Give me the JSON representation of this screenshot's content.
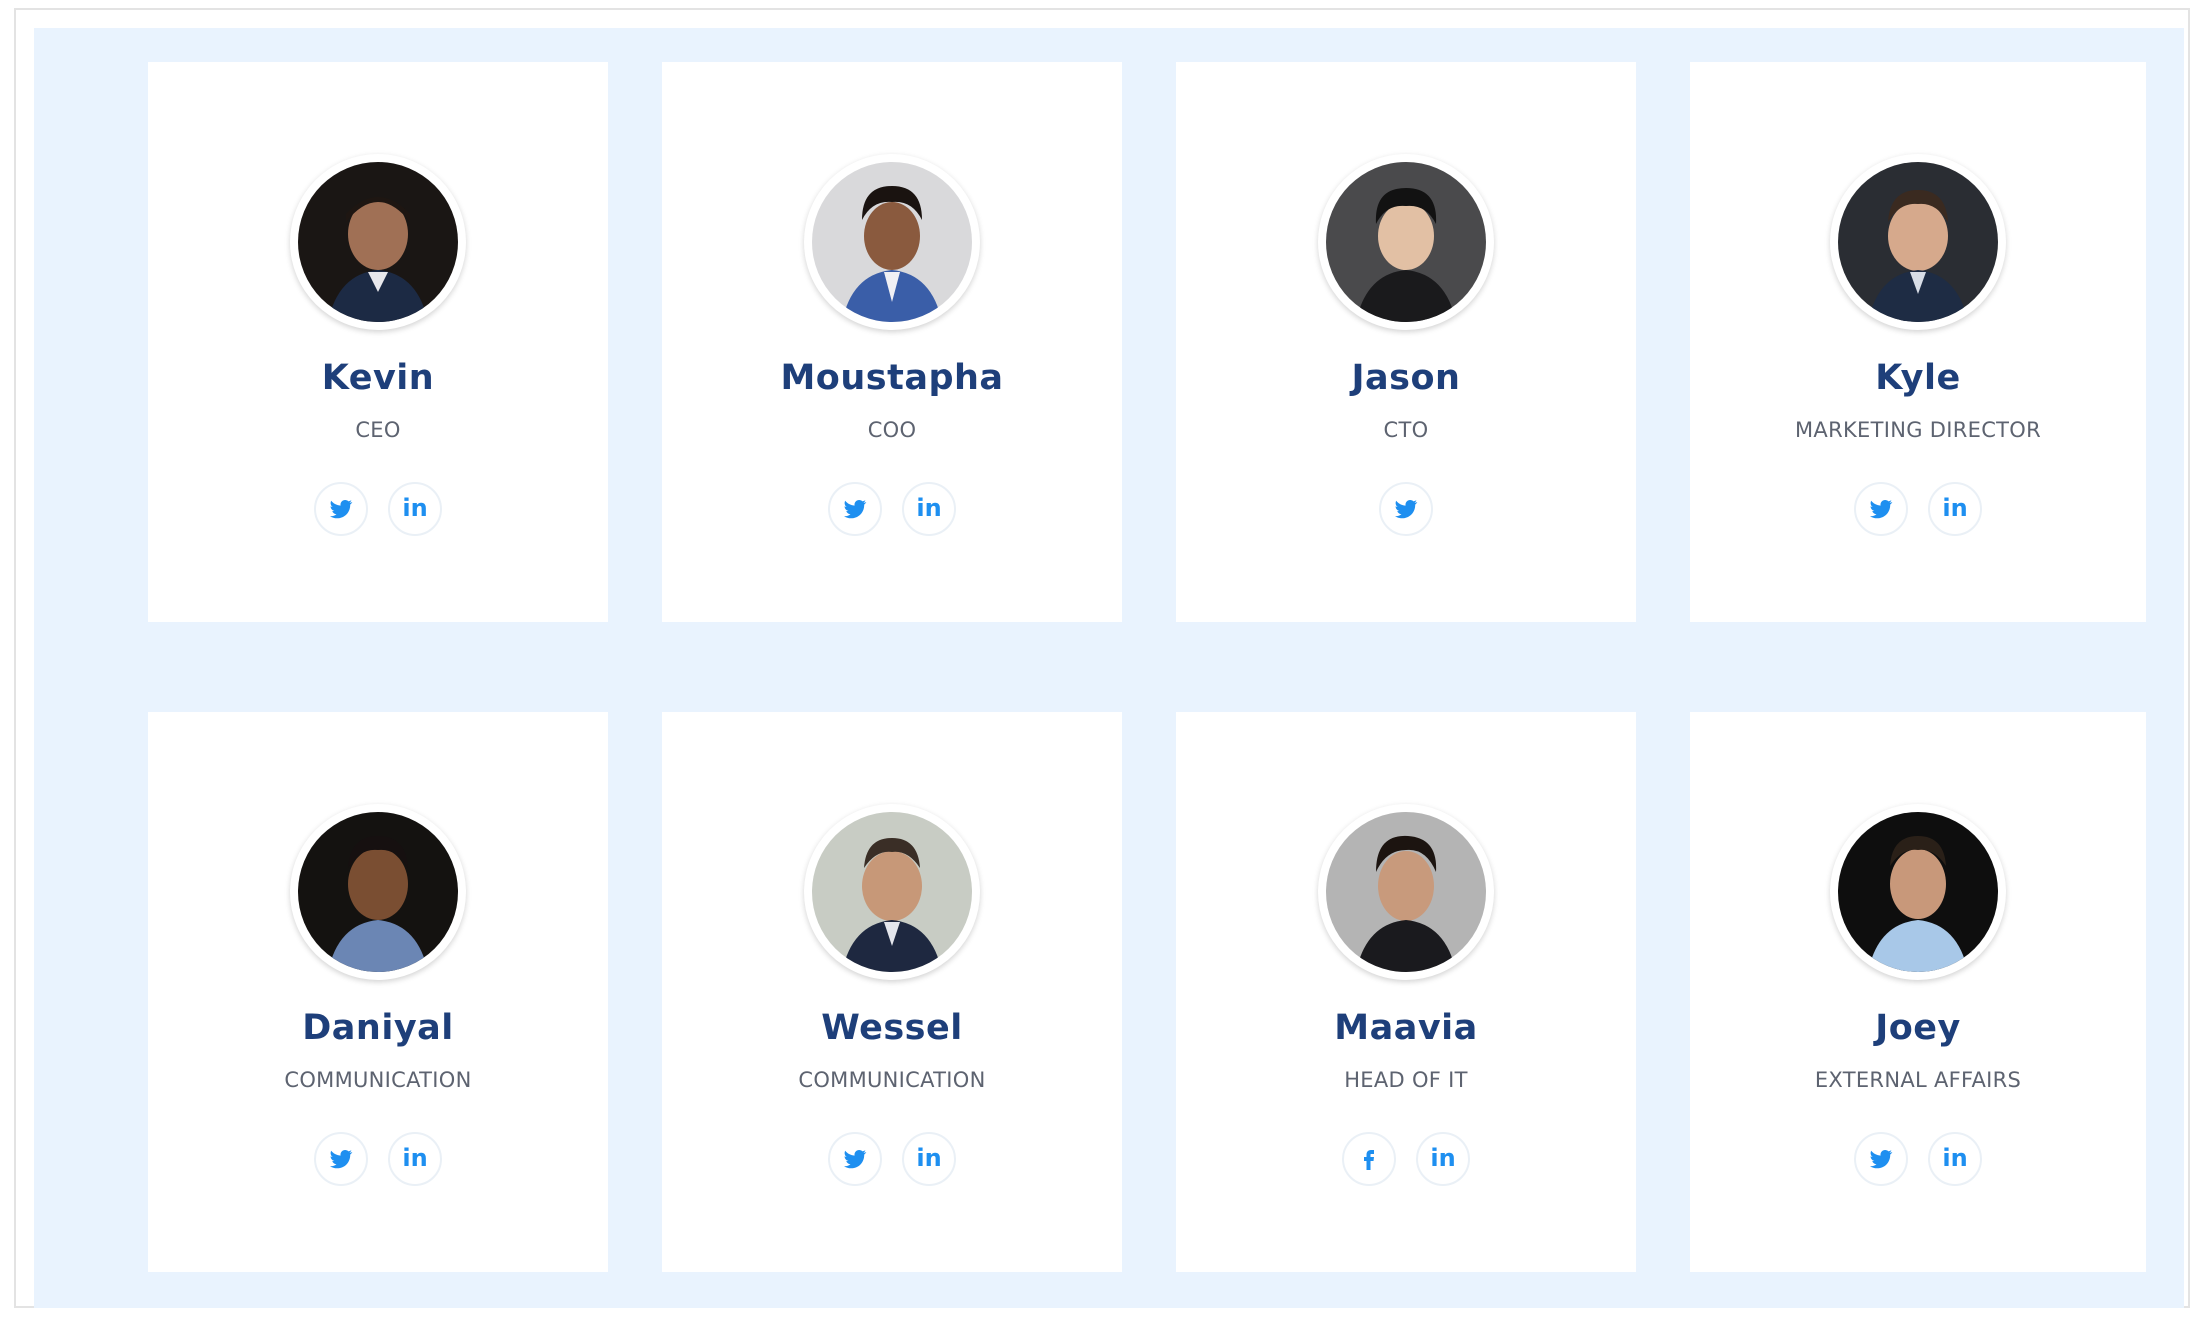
{
  "team": [
    {
      "name": "Kevin",
      "role": "CEO",
      "socials": [
        "twitter",
        "linkedin"
      ]
    },
    {
      "name": "Moustapha",
      "role": "COO",
      "socials": [
        "twitter",
        "linkedin"
      ]
    },
    {
      "name": "Jason",
      "role": "CTO",
      "socials": [
        "twitter"
      ]
    },
    {
      "name": "Kyle",
      "role": "MARKETING DIRECTOR",
      "socials": [
        "twitter",
        "linkedin"
      ]
    },
    {
      "name": "Daniyal",
      "role": "COMMUNICATION",
      "socials": [
        "twitter",
        "linkedin"
      ]
    },
    {
      "name": "Wessel",
      "role": "COMMUNICATION",
      "socials": [
        "twitter",
        "linkedin"
      ]
    },
    {
      "name": "Maavia",
      "role": "HEAD OF IT",
      "socials": [
        "facebook",
        "linkedin"
      ]
    },
    {
      "name": "Joey",
      "role": "EXTERNAL AFFAIRS",
      "socials": [
        "twitter",
        "linkedin"
      ]
    }
  ],
  "icons": {
    "twitter": "twitter-icon",
    "linkedin": "linkedin-icon",
    "facebook": "facebook-icon"
  },
  "linkedin_glyph": "in",
  "colors": {
    "background_panel": "#e9f3fe",
    "card": "#ffffff",
    "name_text": "#1e3f7a",
    "role_text": "#5d6370",
    "social_icon": "#1e8ff0"
  }
}
